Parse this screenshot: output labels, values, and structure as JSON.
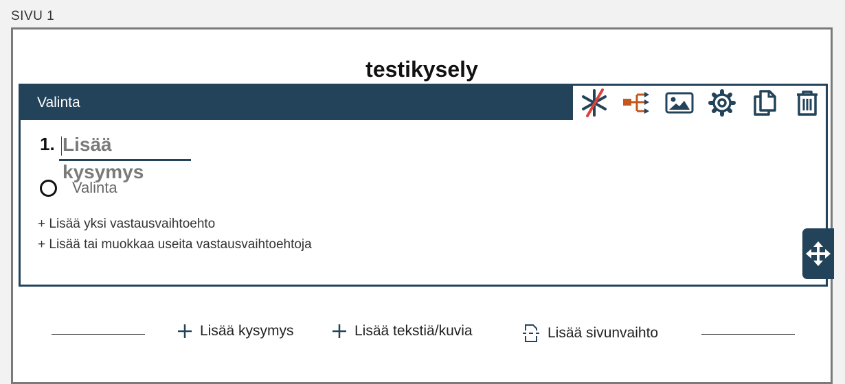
{
  "page": {
    "label": "SIVU  1"
  },
  "survey": {
    "title": "testikysely"
  },
  "question": {
    "type_label": "Valinta",
    "number": "1.",
    "title_placeholder": "Lisää kysymys",
    "options": [
      {
        "label": "Valinta"
      }
    ],
    "add_one_option": "+ Lisää yksi vastausvaihtoehto",
    "add_multiple_options": "+ Lisää tai muokkaa useita vastausvaihtoehtoja"
  },
  "toolbar_icons": [
    "required-toggle-icon",
    "logic-branch-icon",
    "image-icon",
    "gear-icon",
    "copy-icon",
    "trash-icon"
  ],
  "actions": {
    "add_question": "Lisää kysymys",
    "add_text_images": "Lisää tekstiä/kuvia",
    "add_page_break": "Lisää sivunvaihto"
  },
  "colors": {
    "primary": "#22435a",
    "accent": "#c4571b",
    "required_strike": "#d9433a"
  }
}
